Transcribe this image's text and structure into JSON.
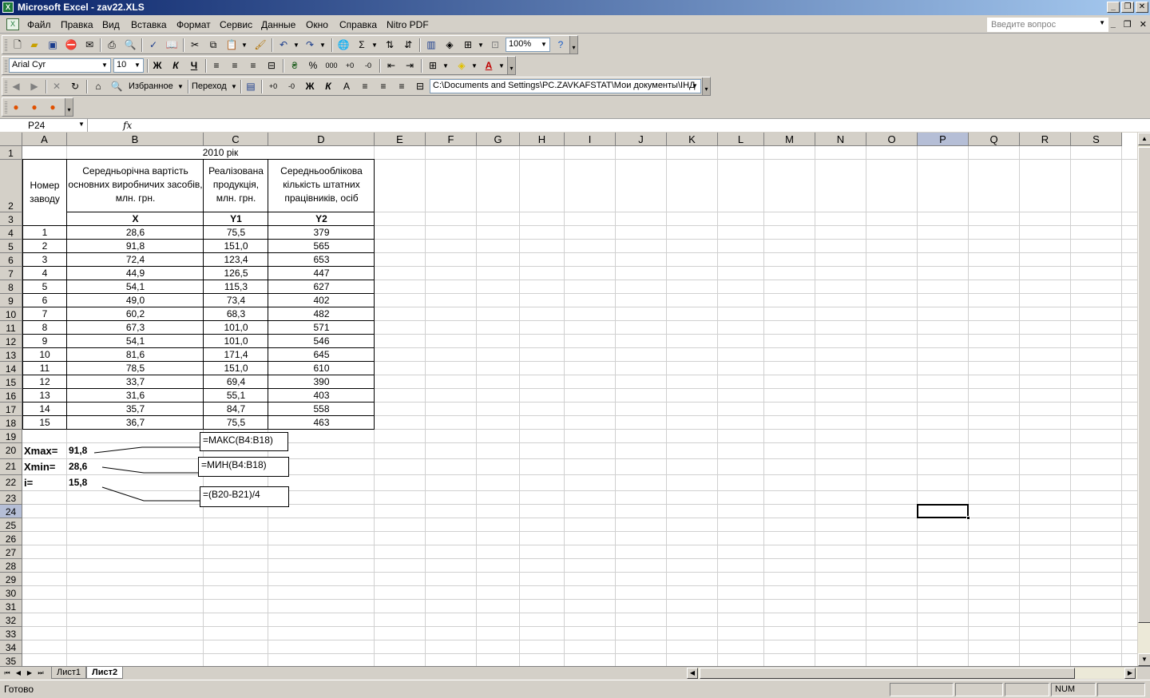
{
  "window": {
    "title": "Microsoft Excel - zav22.XLS",
    "app_icon": "excel-icon",
    "controls": [
      "_",
      "❐",
      "✕"
    ]
  },
  "menu": {
    "items": [
      "Файл",
      "Правка",
      "Вид",
      "Вставка",
      "Формат",
      "Сервис",
      "Данные",
      "Окно",
      "Справка",
      "Nitro PDF"
    ],
    "help_placeholder": "Введите вопрос",
    "doc_controls": [
      "_",
      "❐",
      "✕"
    ]
  },
  "toolbar_standard": {
    "zoom": "100%"
  },
  "toolbar_format": {
    "font": "Arial Cyr",
    "size": "10",
    "bold": "Ж",
    "italic": "К",
    "underline": "Ч"
  },
  "toolbar_web": {
    "favorites": "Избранное",
    "go": "Переход",
    "bold": "Ж",
    "italic": "К",
    "address": "C:\\Documents and Settings\\PC.ZAVKAFSTAT\\Мои документы\\ІНД"
  },
  "formula_bar": {
    "name_box": "P24",
    "fx": "fx",
    "formula": ""
  },
  "sheet": {
    "columns": [
      "A",
      "B",
      "C",
      "D",
      "E",
      "F",
      "G",
      "H",
      "I",
      "J",
      "K",
      "L",
      "M",
      "N",
      "O",
      "P",
      "Q",
      "R",
      "S"
    ],
    "selected_column": "P",
    "selected_row": "24",
    "rows": [
      "1",
      "2",
      "3",
      "4",
      "5",
      "6",
      "7",
      "8",
      "9",
      "10",
      "11",
      "12",
      "13",
      "14",
      "15",
      "16",
      "17",
      "18",
      "19",
      "20",
      "21",
      "22",
      "23",
      "24",
      "25",
      "26",
      "27",
      "28",
      "29",
      "30",
      "31",
      "32",
      "33",
      "34",
      "35"
    ],
    "title": "2010 рік",
    "headers": {
      "a": "Номер заводу",
      "b": "Середньорічна вартість основних виробничих засобів, млн. грн.",
      "c": "Реалізована продукція, млн. грн.",
      "d": "Середньооблікова кількість штатних працівників, осіб"
    },
    "symbols": {
      "b": "X",
      "c": "Y1",
      "d": "Y2"
    },
    "data": [
      [
        "1",
        "28,6",
        "75,5",
        "379"
      ],
      [
        "2",
        "91,8",
        "151,0",
        "565"
      ],
      [
        "3",
        "72,4",
        "123,4",
        "653"
      ],
      [
        "4",
        "44,9",
        "126,5",
        "447"
      ],
      [
        "5",
        "54,1",
        "115,3",
        "627"
      ],
      [
        "6",
        "49,0",
        "73,4",
        "402"
      ],
      [
        "7",
        "60,2",
        "68,3",
        "482"
      ],
      [
        "8",
        "67,3",
        "101,0",
        "571"
      ],
      [
        "9",
        "54,1",
        "101,0",
        "546"
      ],
      [
        "10",
        "81,6",
        "171,4",
        "645"
      ],
      [
        "11",
        "78,5",
        "151,0",
        "610"
      ],
      [
        "12",
        "33,7",
        "69,4",
        "390"
      ],
      [
        "13",
        "31,6",
        "55,1",
        "403"
      ],
      [
        "14",
        "35,7",
        "84,7",
        "558"
      ],
      [
        "15",
        "36,7",
        "75,5",
        "463"
      ]
    ],
    "stats": [
      {
        "label": "Xmax=",
        "value": "91,8",
        "formula": "=МАКС(B4:B18)"
      },
      {
        "label": "Xmin=",
        "value": "28,6",
        "formula": "=МИН(B4:B18)"
      },
      {
        "label": "i=",
        "value": "15,8",
        "formula": "=(B20-B21)/4"
      }
    ]
  },
  "tabs": [
    "Лист1",
    "Лист2"
  ],
  "active_tab": "Лист2",
  "status": {
    "text": "Готово",
    "num": "NUM"
  }
}
